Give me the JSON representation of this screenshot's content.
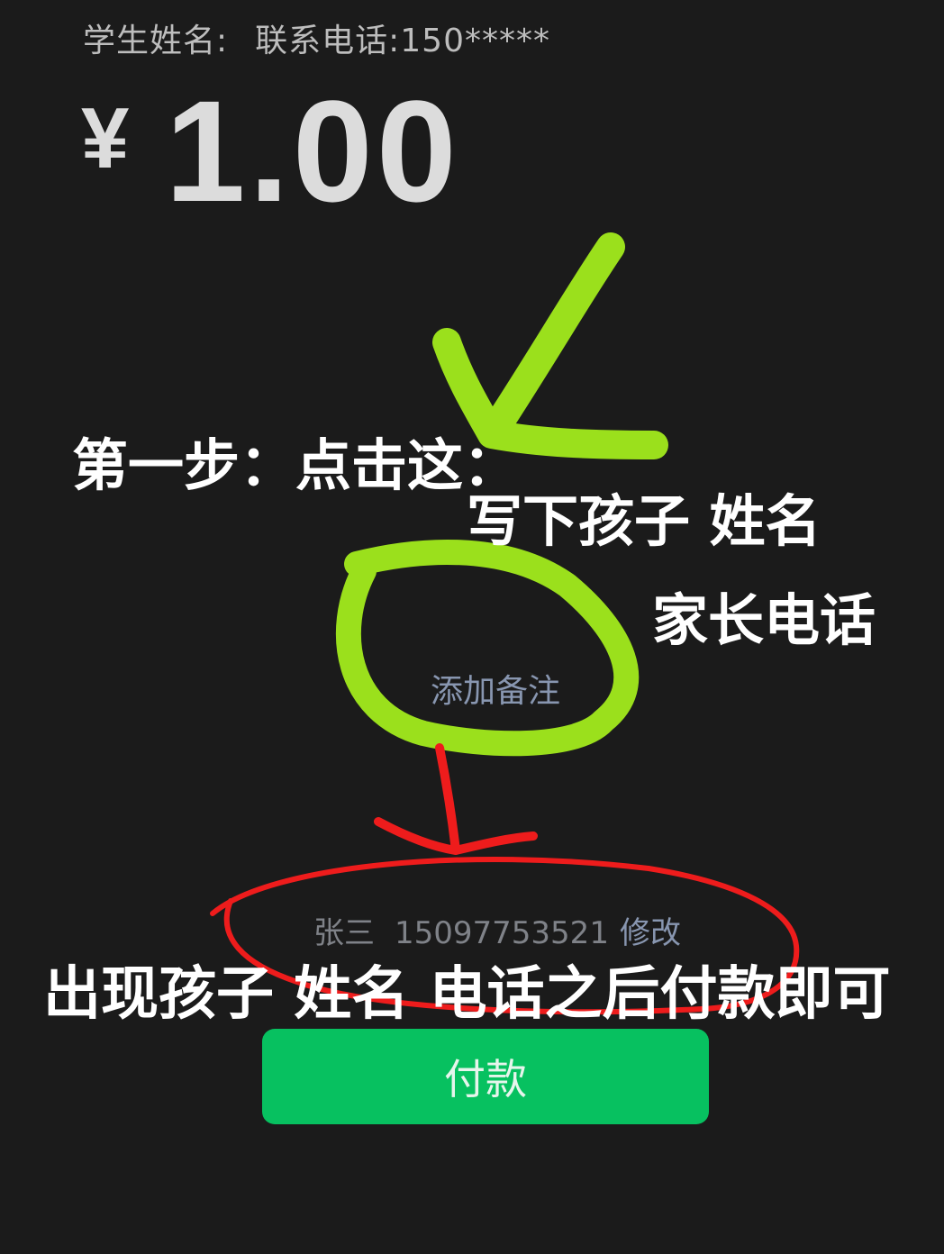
{
  "header": {
    "student_name_label": "学生姓名:",
    "contact_phone_label": "联系电话:150*****"
  },
  "payment": {
    "currency_symbol": "¥",
    "amount": "1.00"
  },
  "remark": {
    "add_label": "添加备注",
    "filled_name": "张三",
    "filled_phone": "15097753521",
    "edit_label": "修改"
  },
  "actions": {
    "pay_label": "付款"
  },
  "annotations": {
    "step1": "第一步：点击这：",
    "write_child_name": "写下孩子 姓名",
    "parent_phone": "家长电话",
    "final_instruction": "出现孩子 姓名 电话之后付款即可",
    "colors": {
      "green_marker": "#9be01c",
      "red_marker": "#ee1c1c"
    }
  }
}
